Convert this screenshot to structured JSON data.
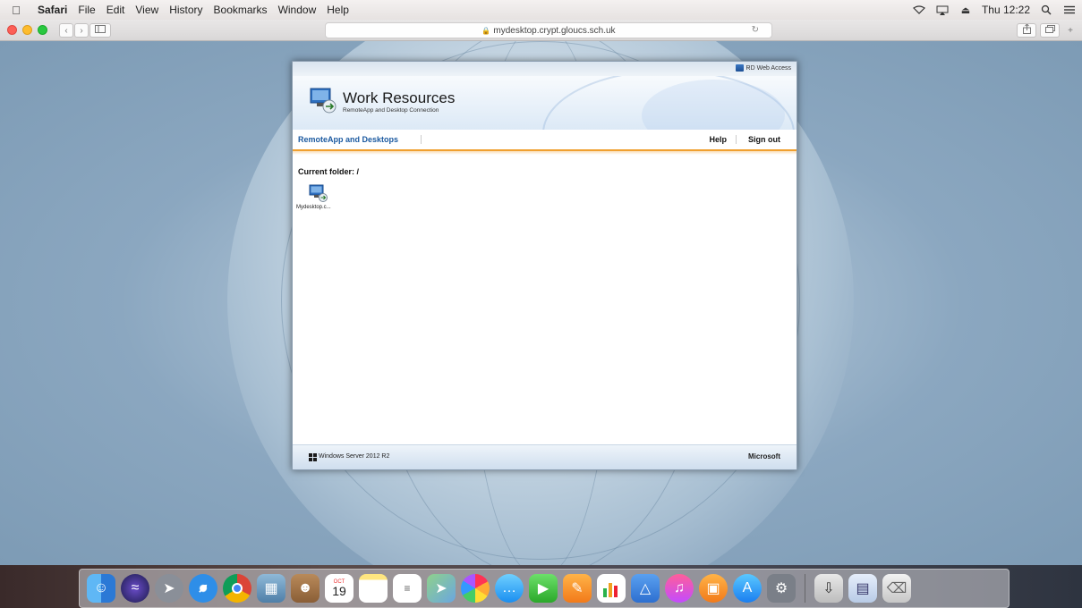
{
  "menubar": {
    "app_name": "Safari",
    "items": [
      "File",
      "Edit",
      "View",
      "History",
      "Bookmarks",
      "Window",
      "Help"
    ],
    "clock": "Thu 12:22"
  },
  "toolbar": {
    "url": "mydesktop.crypt.gloucs.sch.uk"
  },
  "rdweb": {
    "access_label": "RD Web Access",
    "title": "Work Resources",
    "subtitle": "RemoteApp and Desktop Connection",
    "nav": {
      "remote_tab": "RemoteApp and Desktops",
      "help": "Help",
      "sign_out": "Sign out"
    },
    "current_folder": "Current folder: /",
    "resources": [
      {
        "label": "Mydesktop.c..."
      }
    ],
    "footer": {
      "product": "Windows Server 2012 R2",
      "vendor": "Microsoft"
    }
  },
  "dock": {
    "calendar_month": "OCT",
    "calendar_day": "19",
    "icons": [
      "finder-icon",
      "siri-icon",
      "launchpad-icon",
      "safari-icon",
      "chrome-icon",
      "preview-icon",
      "contacts-icon",
      "calendar-icon",
      "notes-icon",
      "reminders-icon",
      "maps-icon",
      "photos-icon",
      "messages-icon",
      "facetime-icon",
      "pages-icon",
      "numbers-icon",
      "keynote-icon",
      "itunes-icon",
      "ibooks-icon",
      "app-store-icon",
      "system-preferences-icon",
      "downloads-icon",
      "documents-icon",
      "trash-icon"
    ]
  }
}
